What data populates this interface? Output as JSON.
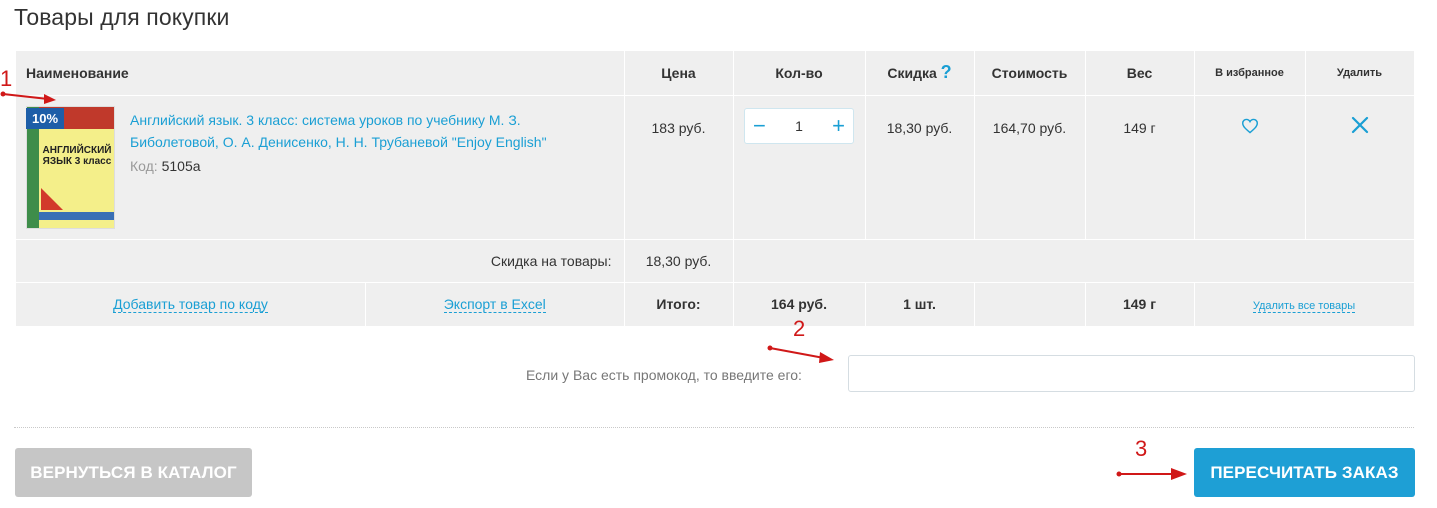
{
  "page": {
    "title": "Товары для покупки"
  },
  "table": {
    "headers": {
      "name": "Наименование",
      "price": "Цена",
      "qty": "Кол-во",
      "discount": "Скидка",
      "discount_help": "?",
      "cost": "Стоимость",
      "weight": "Вес",
      "favorite": "В избранное",
      "delete": "Удалить"
    },
    "item": {
      "badge": "10%",
      "cover_text": "АНГЛИЙСКИЙ ЯЗЫК 3 класс",
      "title": "Английский язык. 3 класс: система уроков по учебнику М. З. Биболетовой, О. А. Денисенко, Н. Н. Трубаневой \"Enjoy English\"",
      "code_label": "Код:",
      "code": "5105а",
      "price": "183 руб.",
      "qty_minus": "−",
      "qty": "1",
      "qty_plus": "+",
      "discount": "18,30 руб.",
      "cost": "164,70 руб.",
      "weight": "149 г",
      "favorite_icon": "heart-icon",
      "remove_icon": "close-icon"
    },
    "discount_row": {
      "label": "Скидка на товары:",
      "value": "18,30 руб."
    },
    "total_row": {
      "add_by_code": "Добавить товар по коду",
      "export_excel": "Экспорт в Excel",
      "total_label": "Итого:",
      "total_sum": "164 руб.",
      "total_qty": "1 шт.",
      "total_weight": "149 г",
      "delete_all": "Удалить все товары"
    }
  },
  "promo": {
    "label": "Если у Вас есть промокод, то введите его:",
    "value": ""
  },
  "buttons": {
    "back": "Вернуться в каталог",
    "recalc": "Пересчитать заказ"
  },
  "annotations": [
    "1",
    "2",
    "3"
  ],
  "colors": {
    "accent": "#1e9fd5",
    "link": "#1a9fd4",
    "annotation": "#d01818",
    "table_bg": "#efefef"
  }
}
